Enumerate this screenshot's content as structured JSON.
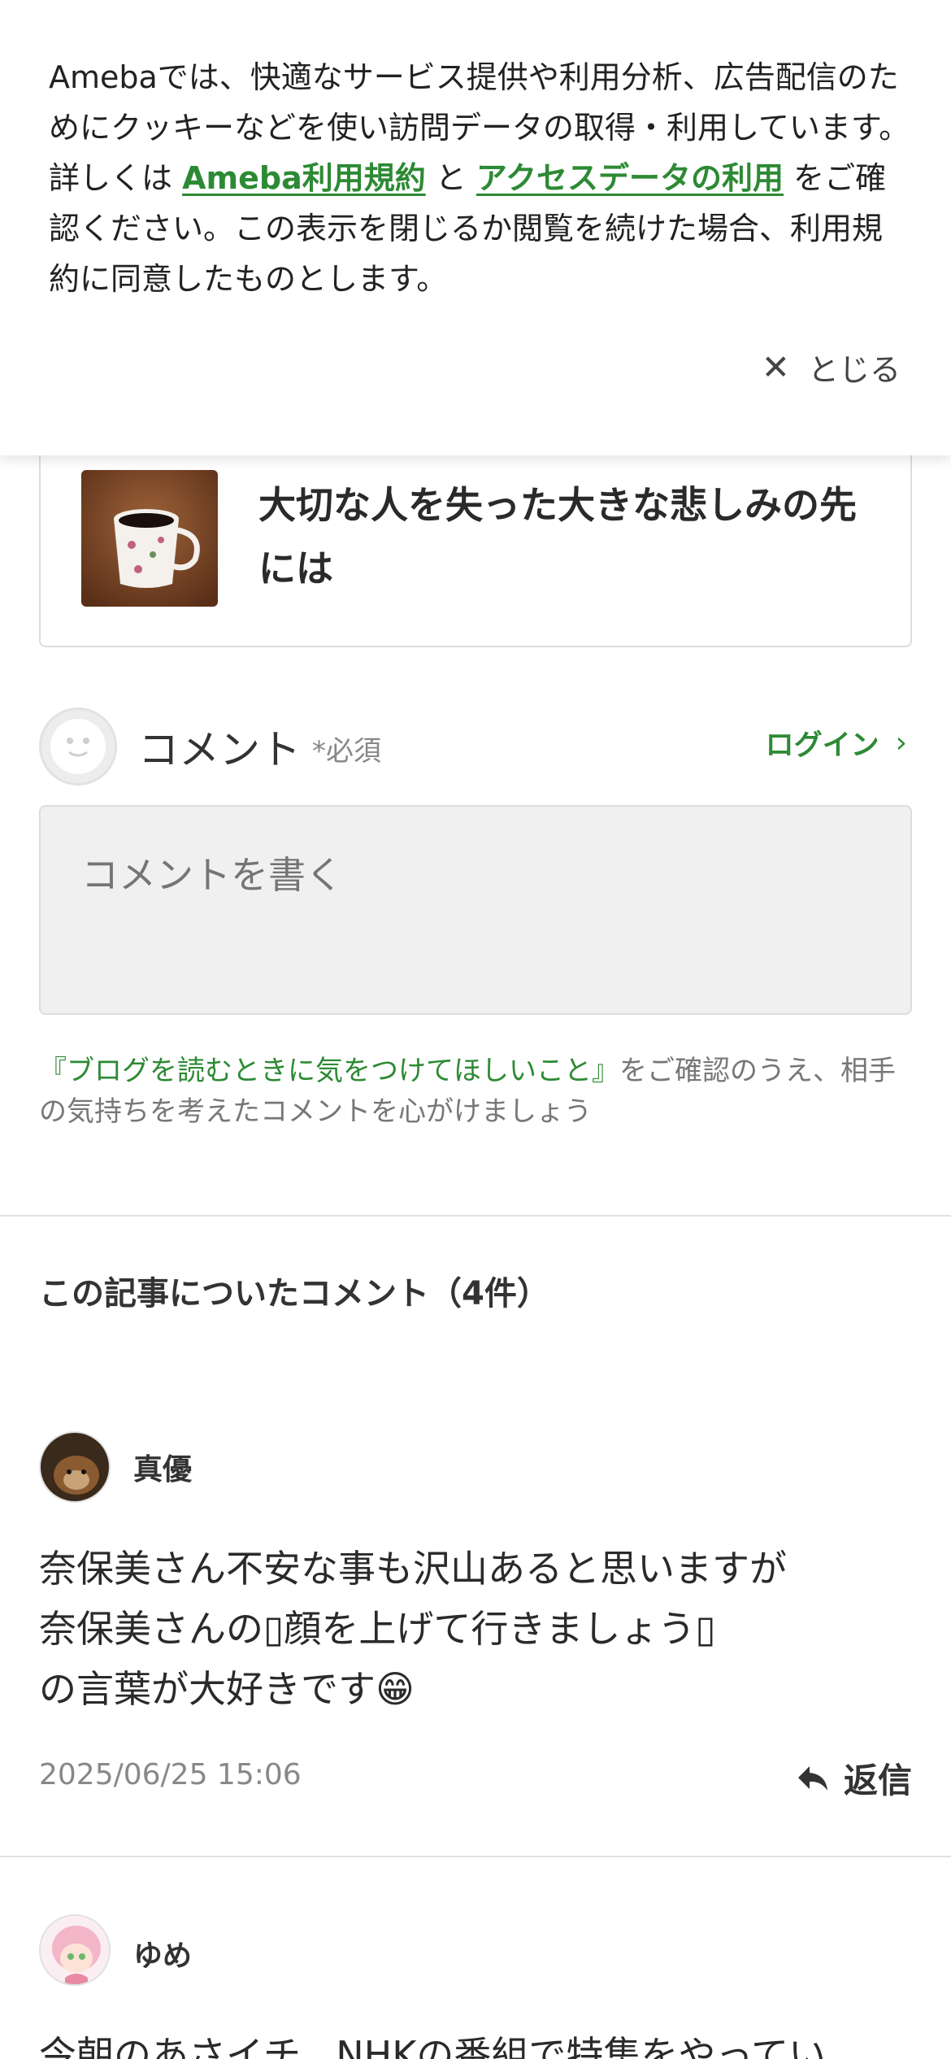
{
  "cookie_banner": {
    "text_before": "Amebaでは、快適なサービス提供や利用分析、広告配信のためにクッキーなどを使い訪問データの取得・利用しています。詳しくは ",
    "link_terms": "Ameba利用規約",
    "text_and": " と ",
    "link_access": "アクセスデータの利用",
    "text_after": " をご確認ください。この表示を閉じるか閲覧を続けた場合、利用規約に同意したものとします。",
    "close_label": "とじる"
  },
  "related_article": {
    "title": "大切な人を失った大きな悲しみの先には"
  },
  "comment_form": {
    "label": "コメント",
    "required": "*必須",
    "login": "ログイン",
    "placeholder": "コメントを書く",
    "notice_link": "『ブログを読むときに気をつけてほしいこと』",
    "notice_text": "をご確認のうえ、相手の気持ちを考えたコメントを心がけましょう"
  },
  "comments_section": {
    "title": "この記事についたコメント（4件）",
    "comments": [
      {
        "author": "真優",
        "body": "奈保美さん不安な事も沢山あると思いますが\n奈保美さんの▯顔を上げて行きましょう▯\nの言葉が大好きです😁",
        "date": "2025/06/25 15:06",
        "reply_label": "返信"
      },
      {
        "author": "ゆめ",
        "body": "今朝のあさイチ、NHKの番組で特集をやってい"
      }
    ]
  },
  "colors": {
    "accent_green": "#2d8a34",
    "text": "#333333",
    "muted": "#888888"
  }
}
